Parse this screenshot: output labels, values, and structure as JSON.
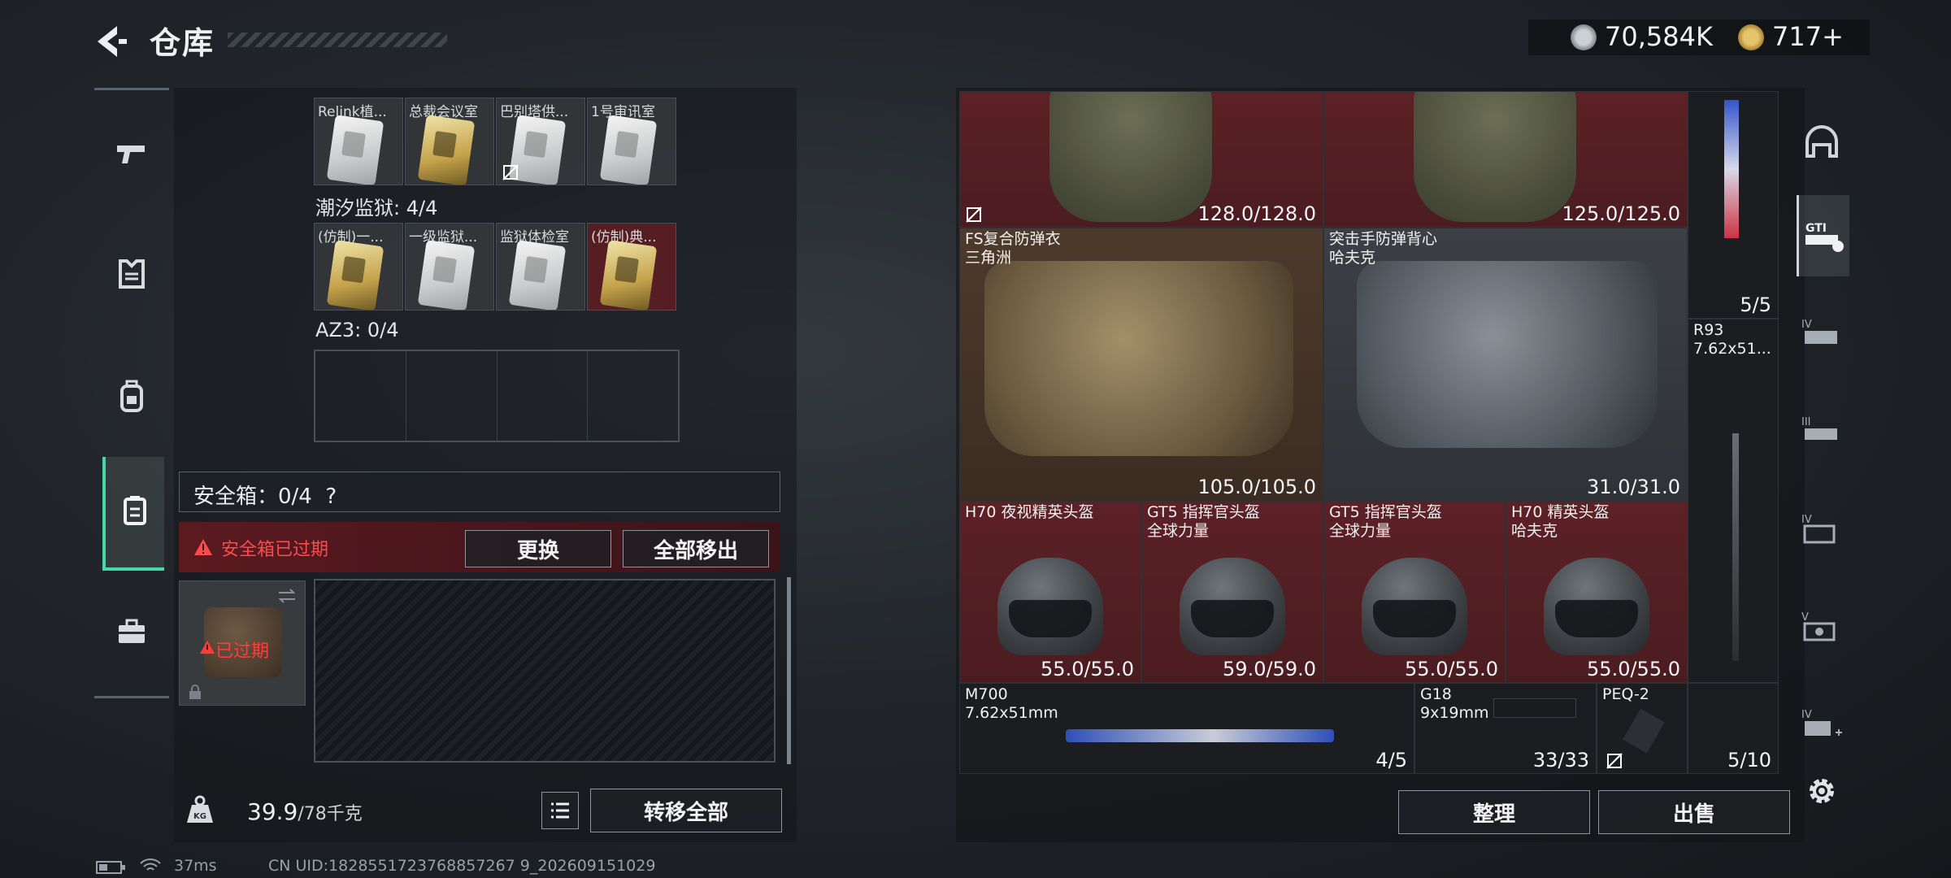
{
  "header": {
    "title": "仓库",
    "currency1": "70,584K",
    "currency2": "717+"
  },
  "nav": {
    "items": [
      "weapons",
      "armor",
      "backpack",
      "safe-box",
      "toolkit"
    ],
    "active": "safe-box"
  },
  "keycards": {
    "row1": [
      "Relink植...",
      "总裁会议室",
      "巴别塔供...",
      "1号审讯室"
    ],
    "prison_title": "潮汐监狱: 4/4",
    "row2": [
      "(仿制)一...",
      "一级监狱...",
      "监狱体检室",
      "(仿制)典..."
    ],
    "az3_title": "AZ3: 0/4"
  },
  "safe": {
    "title": "安全箱：0/4",
    "help": "?",
    "expired_warning": "安全箱已过期",
    "replace_label": "更换",
    "remove_all_label": "全部移出",
    "item_label": "已过期"
  },
  "weight": {
    "value": "39.9",
    "unit": "/78千克"
  },
  "transfer_all_label": "转移全部",
  "inventory": {
    "top_vests": [
      {
        "dur": "128.0/128.0"
      },
      {
        "dur": "125.0/125.0"
      }
    ],
    "vest1": {
      "name": "FS复合防弹衣",
      "sub": "三角洲",
      "dur": "105.0/105.0"
    },
    "vest2": {
      "name": "突击手防弹背心",
      "sub": "哈夫克",
      "dur": "31.0/31.0"
    },
    "rifle_top": {
      "dur": "5/5"
    },
    "r93": {
      "name": "R93",
      "sub": "7.62x51..."
    },
    "helmets": [
      {
        "name": "H70 夜视精英头盔",
        "sub": "",
        "dur": "55.0/55.0"
      },
      {
        "name": "GT5 指挥官头盔",
        "sub": "全球力量",
        "dur": "59.0/59.0"
      },
      {
        "name": "GT5 指挥官头盔",
        "sub": "全球力量",
        "dur": "55.0/55.0"
      },
      {
        "name": "H70 精英头盔",
        "sub": "哈夫克",
        "dur": "55.0/55.0"
      }
    ],
    "m700": {
      "name": "M700",
      "sub": "7.62x51mm",
      "dur": "4/5"
    },
    "g18": {
      "name": "G18",
      "sub": "9x19mm",
      "dur": "33/33"
    },
    "peq": {
      "name": "PEQ-2"
    },
    "sniper": {
      "dur": "5/10"
    }
  },
  "actions": {
    "organize": "整理",
    "sell": "出售"
  },
  "side_tabs": [
    "helmet-slot",
    "GTI",
    "IV",
    "III",
    "IV",
    "V",
    "IV+"
  ],
  "status": {
    "ping": "37ms",
    "uid": "CN UID:1828551723768857267 9_202609151029"
  }
}
